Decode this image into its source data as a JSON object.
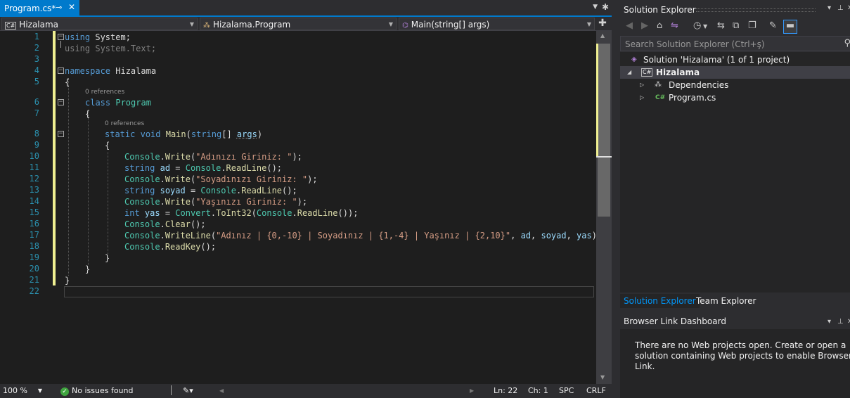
{
  "editor": {
    "doc_tab": {
      "title": "Program.cs*",
      "pin": "⊸",
      "close": "✕"
    },
    "tab_dropdown": "▼",
    "tab_settings": "✱",
    "nav": {
      "project": {
        "label": "Hizalama",
        "icon": "C#"
      },
      "type": {
        "label": "Hizalama.Program",
        "icon": "⁂"
      },
      "member": {
        "label": "Main(string[] args)",
        "icon": "⌬"
      },
      "split_icon": "✚"
    },
    "code_lens": {
      "refs0": "0 references",
      "refs1": "0 references"
    },
    "line_numbers": [
      "1",
      "2",
      "3",
      "4",
      "5",
      "6",
      "7",
      "8",
      "9",
      "10",
      "11",
      "12",
      "13",
      "14",
      "15",
      "16",
      "17",
      "18",
      "19",
      "20",
      "21",
      "22"
    ],
    "code": {
      "l1": [
        "using",
        " System;"
      ],
      "l2": [
        "using System.Text;"
      ],
      "l4": [
        "namespace",
        " Hizalama"
      ],
      "l5": [
        "{"
      ],
      "l6": [
        "class",
        " ",
        "Program"
      ],
      "l7": [
        "{"
      ],
      "l8": [
        "static",
        " ",
        "void",
        " ",
        "Main",
        "(",
        "string",
        "[] ",
        "args",
        ")"
      ],
      "l9": [
        "{"
      ],
      "l10": [
        "Console",
        ".",
        "Write",
        "(",
        "\"Adınızı Giriniz: \"",
        ");"
      ],
      "l11": [
        "string",
        " ",
        "ad",
        " = ",
        "Console",
        ".",
        "ReadLine",
        "();"
      ],
      "l12": [
        "Console",
        ".",
        "Write",
        "(",
        "\"Soyadınızı Giriniz: \"",
        ");"
      ],
      "l13": [
        "string",
        " ",
        "soyad",
        " = ",
        "Console",
        ".",
        "ReadLine",
        "();"
      ],
      "l14": [
        "Console",
        ".",
        "Write",
        "(",
        "\"Yaşınızı Giriniz: \"",
        ");"
      ],
      "l15": [
        "int",
        " ",
        "yas",
        " = ",
        "Convert",
        ".",
        "ToInt32",
        "(",
        "Console",
        ".",
        "ReadLine",
        "());"
      ],
      "l16": [
        "Console",
        ".",
        "Clear",
        "();"
      ],
      "l17": [
        "Console",
        ".",
        "WriteLine",
        "(",
        "\"Adınız | {0,-10} | Soyadınız | {1,-4} | Yaşınız | {2,10}\"",
        ", ",
        "ad",
        ", ",
        "soyad",
        ", ",
        "yas",
        ");"
      ],
      "l18": [
        "Console",
        ".",
        "ReadKey",
        "();"
      ],
      "l19": [
        "}"
      ],
      "l20": [
        "}"
      ],
      "l21": [
        "}"
      ]
    }
  },
  "status_bar": {
    "zoom": "100 %",
    "issues": "No issues found",
    "ok_icon": "✓",
    "brush_icon": "✎▾",
    "line": "Ln: 22",
    "col": "Ch: 1",
    "spc": "SPC",
    "crlf": "CRLF"
  },
  "solution_explorer": {
    "title": "Solution Explorer",
    "window_menu": "▾",
    "pin": "⊥",
    "close": "✕",
    "search_placeholder": "Search Solution Explorer (Ctrl+ş)",
    "tree": [
      {
        "label": "Solution 'Hizalama' (1 of 1 project)",
        "icon": "◈"
      },
      {
        "label": "Hizalama",
        "icon": "C#",
        "expander": "◢"
      },
      {
        "label": "Dependencies",
        "icon": "⁂",
        "expander": "▷"
      },
      {
        "label": "Program.cs",
        "icon": "C#",
        "expander": "▷"
      }
    ],
    "tabs": [
      "Solution Explorer",
      "Team Explorer"
    ]
  },
  "browser_link": {
    "title": "Browser Link Dashboard",
    "message": "There are no Web projects open. Create or open a solution containing Web projects to enable Browser Link."
  }
}
